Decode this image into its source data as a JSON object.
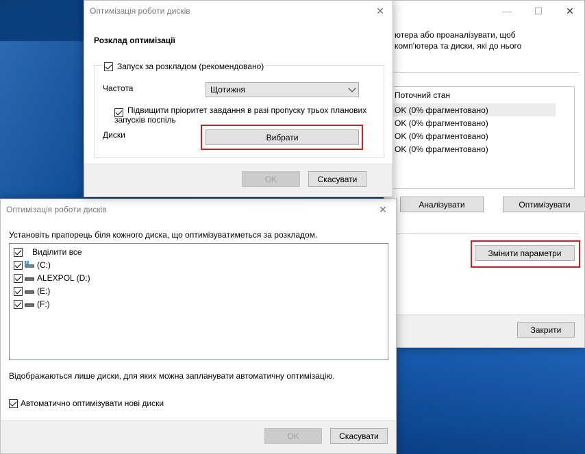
{
  "back_window": {
    "desc_line1": "ютера або проаналізувати, щоб",
    "desc_line2": "комп'ютера та диски, які до нього",
    "status_header": "Поточний стан",
    "status_rows": [
      "OK (0% фрагментовано)",
      "OK (0% фрагментовано)",
      "OK (0% фрагментовано)",
      "OK (0% фрагментовано)"
    ],
    "analyze_label": "Аналізувати",
    "optimize_label": "Оптимізувати",
    "change_settings_label": "Змінити параметри",
    "close_label": "Закрити"
  },
  "schedule_window": {
    "title": "Оптимізація роботи дисків",
    "heading": "Розклад оптимізації",
    "run_on_schedule_label": "Запуск за розкладом (рекомендовано)",
    "frequency_label": "Частота",
    "frequency_value": "Щотижня",
    "priority_line1": "Підвищити пріоритет завдання в разі пропуску трьох планових",
    "priority_line2": "запусків поспіль",
    "drives_label": "Диски",
    "choose_label": "Вибрати",
    "ok_label": "OK",
    "cancel_label": "Скасувати"
  },
  "drives_window": {
    "title": "Оптимізація роботи дисків",
    "instruction": "Установіть прапорець біля кожного диска, що оптимізуватиметься за розкладом.",
    "select_all_label": "Виділити все",
    "drives": [
      {
        "name": "(C:)",
        "icon": "system-drive-icon"
      },
      {
        "name": "ALEXPOL (D:)",
        "icon": "drive-icon"
      },
      {
        "name": "(E:)",
        "icon": "drive-icon"
      },
      {
        "name": "(F:)",
        "icon": "drive-icon"
      }
    ],
    "note": "Відображаються лише диски, для яких можна запланувати автоматичну оптимізацію.",
    "auto_new_label": "Автоматично оптимізувати нові диски",
    "ok_label": "OK",
    "cancel_label": "Скасувати"
  },
  "colors": {
    "highlight": "#e0181e",
    "desktop": "#0a4b95"
  }
}
